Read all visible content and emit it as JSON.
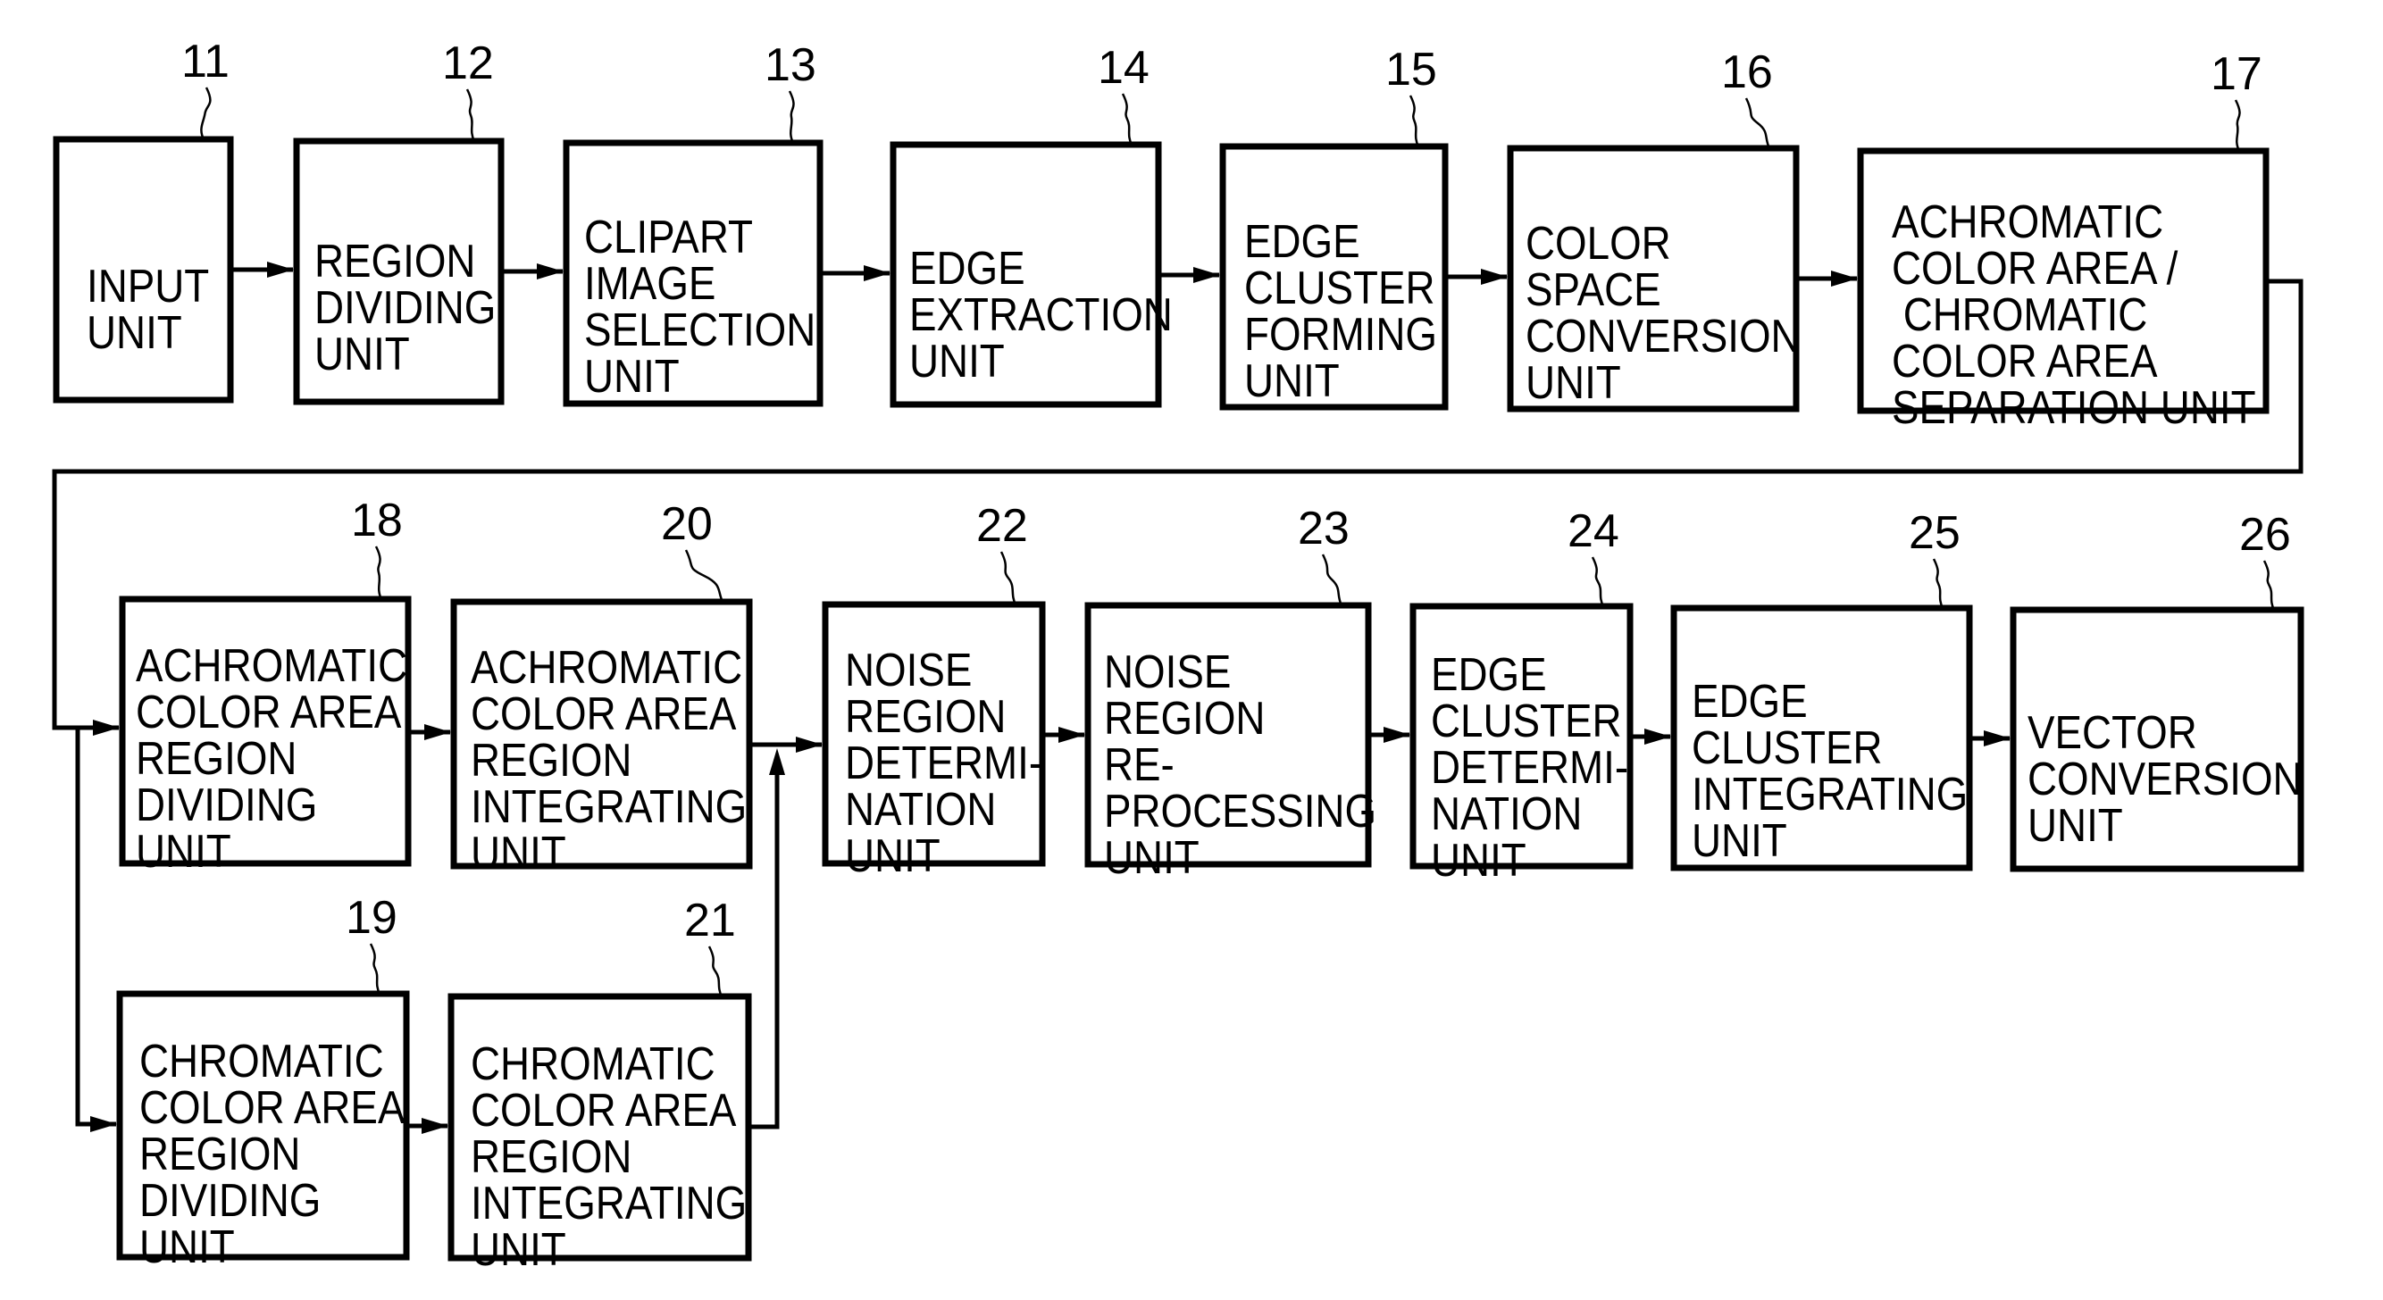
{
  "figure": {
    "type": "block-diagram",
    "description": "Image processing apparatus block diagram",
    "colors": {
      "line": "#000000",
      "background": "#ffffff"
    }
  },
  "blocks": [
    {
      "id": "11",
      "ref": "11",
      "lines": [
        "INPUT",
        "UNIT"
      ]
    },
    {
      "id": "12",
      "ref": "12",
      "lines": [
        "REGION",
        "DIVIDING",
        "UNIT"
      ]
    },
    {
      "id": "13",
      "ref": "13",
      "lines": [
        "CLIPART",
        "IMAGE",
        "SELECTION",
        "UNIT"
      ]
    },
    {
      "id": "14",
      "ref": "14",
      "lines": [
        "EDGE",
        "EXTRACTION",
        "UNIT"
      ]
    },
    {
      "id": "15",
      "ref": "15",
      "lines": [
        "EDGE",
        "CLUSTER",
        "FORMING",
        "UNIT"
      ]
    },
    {
      "id": "16",
      "ref": "16",
      "lines": [
        "COLOR",
        "SPACE",
        "CONVERSION",
        "UNIT"
      ]
    },
    {
      "id": "17",
      "ref": "17",
      "lines": [
        "ACHROMATIC",
        "COLOR AREA /",
        " CHROMATIC",
        "COLOR AREA",
        "SEPARATION UNIT"
      ]
    },
    {
      "id": "18",
      "ref": "18",
      "lines": [
        "ACHROMATIC",
        "COLOR AREA",
        "REGION",
        "DIVIDING",
        "UNIT"
      ]
    },
    {
      "id": "19",
      "ref": "19",
      "lines": [
        "CHROMATIC",
        "COLOR AREA",
        "REGION",
        "DIVIDING",
        "UNIT"
      ]
    },
    {
      "id": "20",
      "ref": "20",
      "lines": [
        "ACHROMATIC",
        "COLOR AREA",
        "REGION",
        "INTEGRATING",
        "UNIT"
      ]
    },
    {
      "id": "21",
      "ref": "21",
      "lines": [
        "CHROMATIC",
        "COLOR AREA",
        "REGION",
        "INTEGRATING",
        "UNIT"
      ]
    },
    {
      "id": "22",
      "ref": "22",
      "lines": [
        "NOISE",
        "REGION",
        "DETERMI-",
        "NATION",
        "UNIT"
      ]
    },
    {
      "id": "23",
      "ref": "23",
      "lines": [
        "NOISE",
        "REGION",
        "RE-",
        "PROCESSING",
        "UNIT"
      ]
    },
    {
      "id": "24",
      "ref": "24",
      "lines": [
        "EDGE",
        "CLUSTER",
        "DETERMI-",
        "NATION",
        "UNIT"
      ]
    },
    {
      "id": "25",
      "ref": "25",
      "lines": [
        "EDGE",
        "CLUSTER",
        "INTEGRATING",
        "UNIT"
      ]
    },
    {
      "id": "26",
      "ref": "26",
      "lines": [
        "VECTOR",
        "CONVERSION",
        "UNIT"
      ]
    }
  ],
  "connections": [
    {
      "from": "11",
      "to": "12"
    },
    {
      "from": "12",
      "to": "13"
    },
    {
      "from": "13",
      "to": "14"
    },
    {
      "from": "14",
      "to": "15"
    },
    {
      "from": "15",
      "to": "16"
    },
    {
      "from": "16",
      "to": "17"
    },
    {
      "from": "17",
      "to": "18"
    },
    {
      "from": "17",
      "to": "19"
    },
    {
      "from": "18",
      "to": "20"
    },
    {
      "from": "19",
      "to": "21"
    },
    {
      "from": "20",
      "to": "22"
    },
    {
      "from": "21",
      "to": "22"
    },
    {
      "from": "22",
      "to": "23"
    },
    {
      "from": "23",
      "to": "24"
    },
    {
      "from": "24",
      "to": "25"
    },
    {
      "from": "25",
      "to": "26"
    }
  ]
}
